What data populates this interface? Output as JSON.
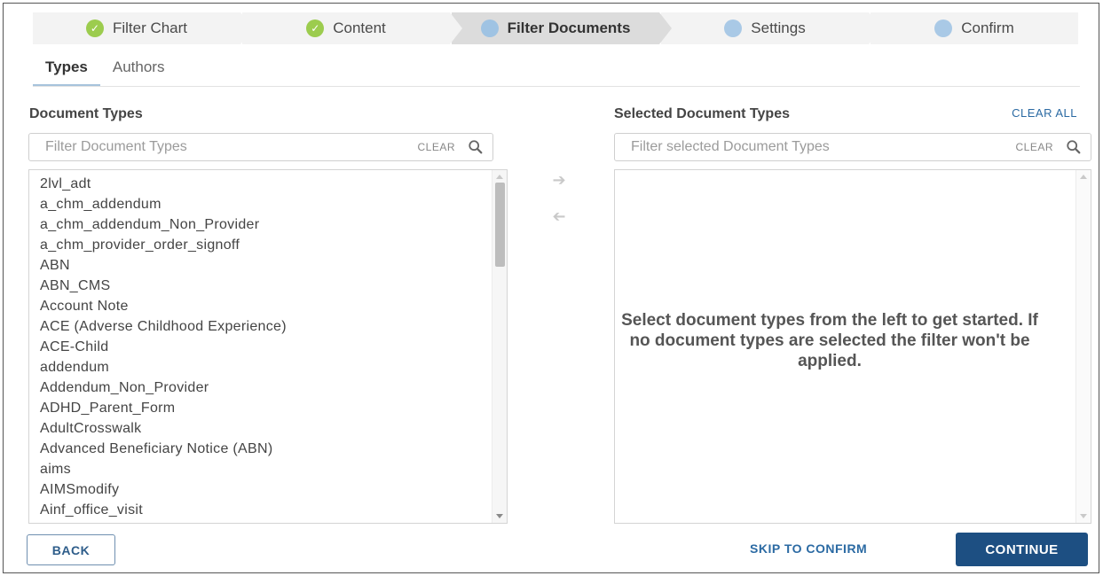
{
  "steps": [
    {
      "label": "Filter Chart",
      "state": "done"
    },
    {
      "label": "Content",
      "state": "done"
    },
    {
      "label": "Filter Documents",
      "state": "current"
    },
    {
      "label": "Settings",
      "state": "todo"
    },
    {
      "label": "Confirm",
      "state": "todo"
    }
  ],
  "subtabs": {
    "types": "Types",
    "authors": "Authors"
  },
  "left": {
    "title": "Document Types",
    "filter_placeholder": "Filter Document Types",
    "clear": "CLEAR",
    "items": [
      "2lvl_adt",
      "a_chm_addendum",
      "a_chm_addendum_Non_Provider",
      "a_chm_provider_order_signoff",
      "ABN",
      "ABN_CMS",
      "Account Note",
      "ACE (Adverse Childhood Experience)",
      "ACE-Child",
      "addendum",
      "Addendum_Non_Provider",
      "ADHD_Parent_Form",
      "AdultCrosswalk",
      "Advanced Beneficiary Notice (ABN)",
      "aims",
      "AIMSmodify",
      "Ainf_office_visit"
    ]
  },
  "right": {
    "title": "Selected Document Types",
    "clear_all": "CLEAR ALL",
    "filter_placeholder": "Filter selected Document Types",
    "clear": "CLEAR",
    "empty_message": "Select document types from the left to get started. If no document types are selected the filter won't be applied."
  },
  "footer": {
    "back": "BACK",
    "skip": "SKIP TO CONFIRM",
    "continue": "CONTINUE"
  },
  "colors": {
    "accent": "#1d4f82",
    "done": "#9ccc4e",
    "pending": "#a9c9e6"
  }
}
